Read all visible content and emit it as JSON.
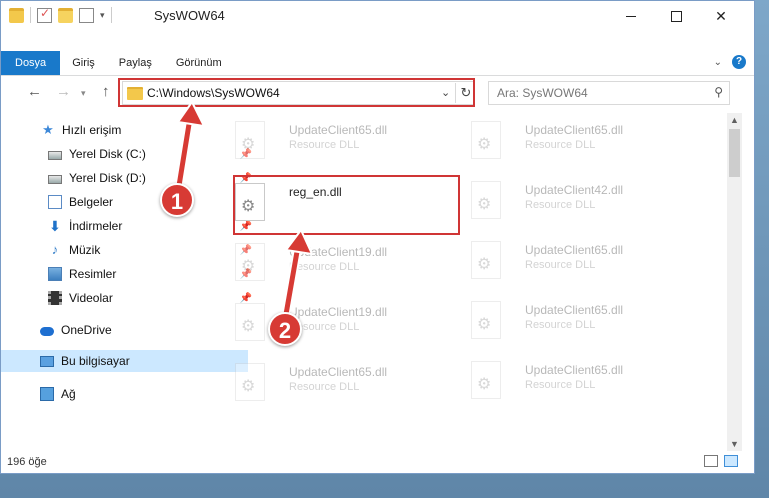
{
  "window": {
    "title": "SysWOW64"
  },
  "ribbon": {
    "tabs": [
      "Dosya",
      "Giriş",
      "Paylaş",
      "Görünüm"
    ]
  },
  "nav": {
    "address": "C:\\Windows\\SysWOW64",
    "search_placeholder": "Ara: SysWOW64"
  },
  "sidebar": {
    "items": [
      {
        "label": "Hızlı erişim",
        "icon": "star-icon"
      },
      {
        "label": "Yerel Disk (C:)",
        "icon": "disk-icon"
      },
      {
        "label": "Yerel Disk (D:)",
        "icon": "disk-icon"
      },
      {
        "label": "Belgeler",
        "icon": "documents-icon"
      },
      {
        "label": "İndirmeler",
        "icon": "download-icon"
      },
      {
        "label": "Müzik",
        "icon": "music-icon"
      },
      {
        "label": "Resimler",
        "icon": "pictures-icon"
      },
      {
        "label": "Videolar",
        "icon": "videos-icon"
      },
      {
        "label": "OneDrive",
        "icon": "cloud-icon"
      },
      {
        "label": "Bu bilgisayar",
        "icon": "computer-icon"
      },
      {
        "label": "Ağ",
        "icon": "network-icon"
      }
    ]
  },
  "files": {
    "left": [
      {
        "name": "UpdateClient65.dll",
        "type": "Resource DLL"
      },
      {
        "name": "reg_en.dll",
        "type": ""
      },
      {
        "name": "UpdateClient19.dll",
        "type": "Resource DLL"
      },
      {
        "name": "UpdateClient19.dll",
        "type": "Resource DLL"
      },
      {
        "name": "UpdateClient65.dll",
        "type": "Resource DLL"
      }
    ],
    "right": [
      {
        "name": "UpdateClient65.dll",
        "type": "Resource DLL"
      },
      {
        "name": "UpdateClient42.dll",
        "type": "Resource DLL"
      },
      {
        "name": "UpdateClient65.dll",
        "type": "Resource DLL"
      },
      {
        "name": "UpdateClient65.dll",
        "type": "Resource DLL"
      },
      {
        "name": "UpdateClient65.dll",
        "type": "Resource DLL"
      }
    ]
  },
  "status": {
    "count": "196 öğe"
  },
  "callouts": {
    "one": "1",
    "two": "2"
  },
  "colors": {
    "accent": "#1979ca",
    "highlight": "#d03535",
    "selected": "#cce8ff"
  }
}
